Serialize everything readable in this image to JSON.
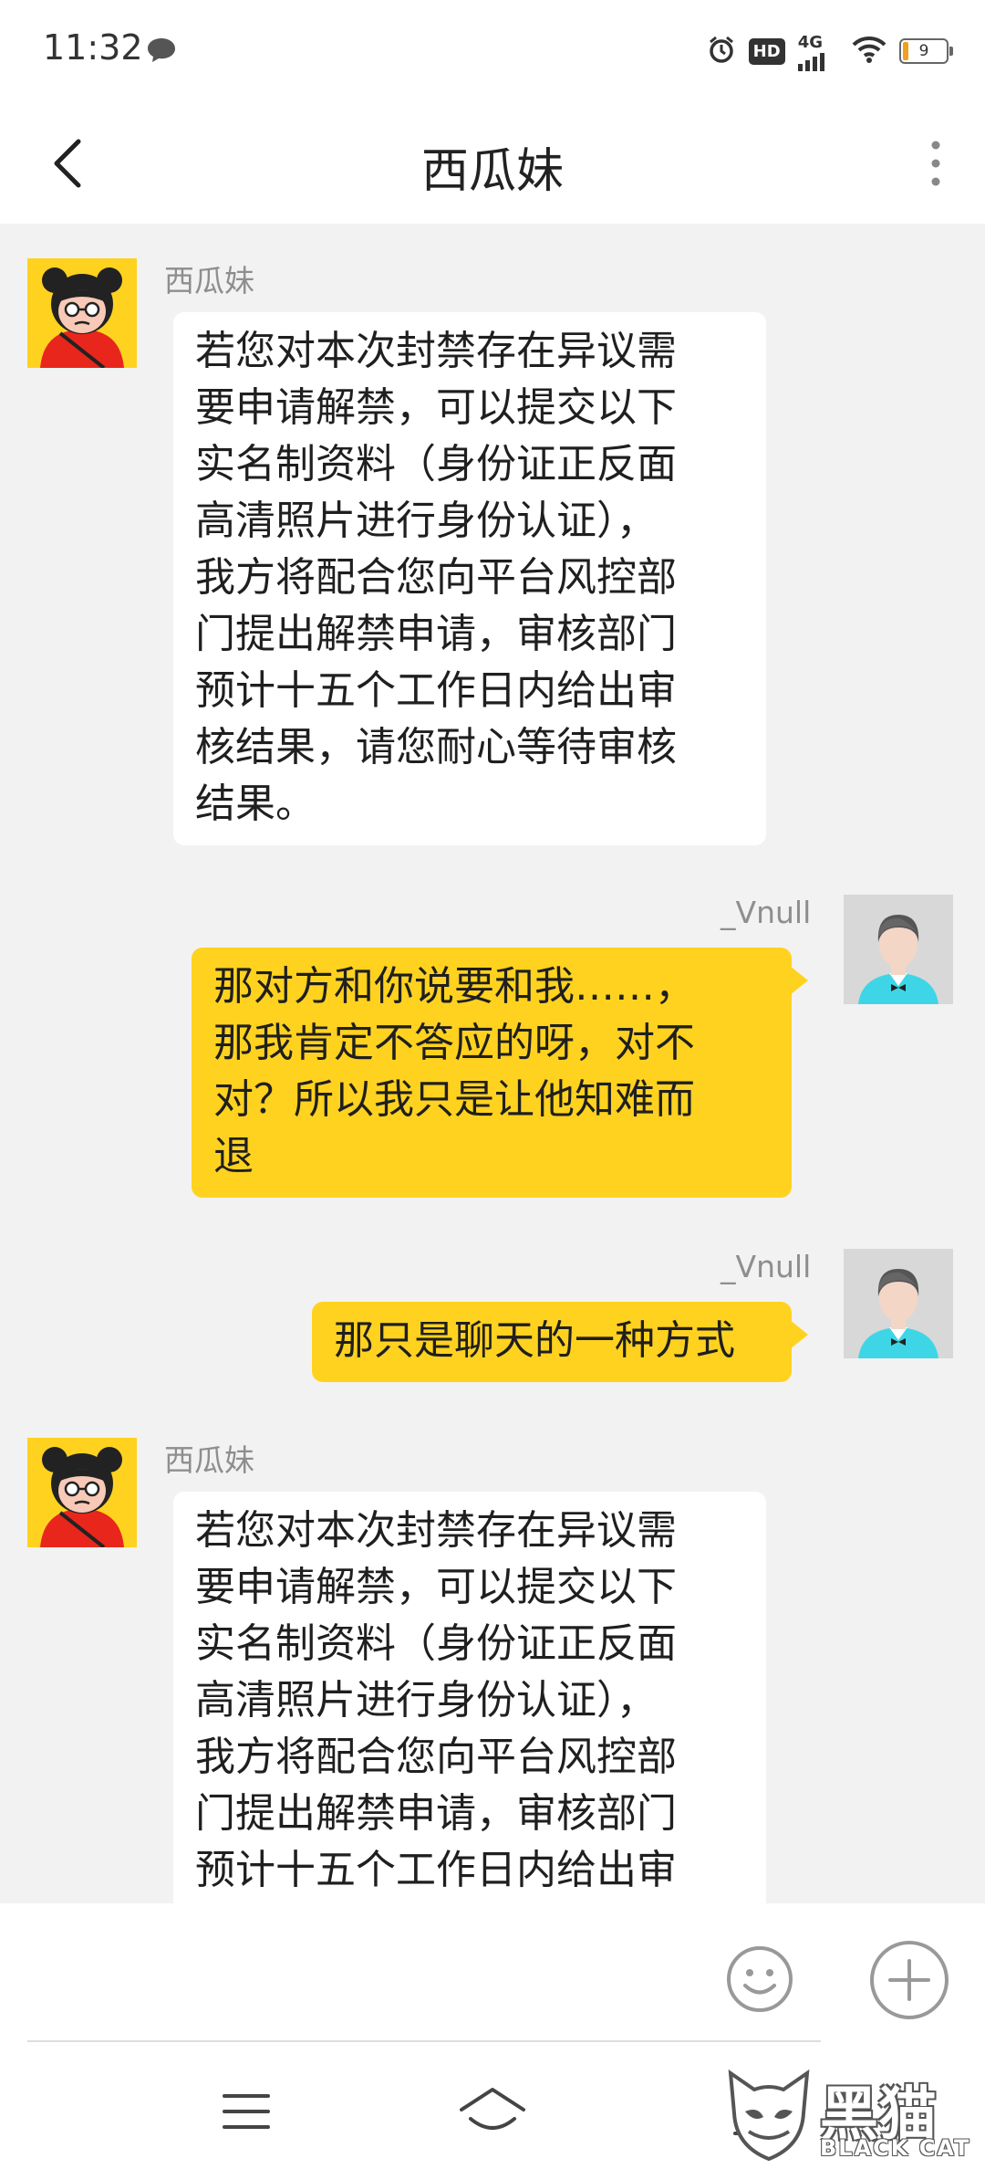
{
  "status_bar": {
    "time": "11:32",
    "network": "4G",
    "hd": "HD",
    "battery": "9"
  },
  "header": {
    "title": "西瓜妹"
  },
  "messages": [
    {
      "direction": "in",
      "sender": "西瓜妹",
      "avatar": "girl-avatar",
      "lines": [
        "若您对本次封禁存在异议需",
        "要申请解禁，可以提交以下",
        "实名制资料（身份证正反面",
        "高清照片进行身份认证），",
        "我方将配合您向平台风控部",
        "门提出解禁申请，审核部门",
        "预计十五个工作日内给出审",
        "核结果，请您耐心等待审核",
        "结果。"
      ]
    },
    {
      "direction": "out",
      "sender": "_Vnull",
      "avatar": "man-avatar",
      "lines": [
        "那对方和你说要和我……，",
        "那我肯定不答应的呀，对不",
        "对？所以我只是让他知难而",
        "退"
      ]
    },
    {
      "direction": "out",
      "sender": "_Vnull",
      "avatar": "man-avatar",
      "lines": [
        "那只是聊天的一种方式"
      ]
    },
    {
      "direction": "in",
      "sender": "西瓜妹",
      "avatar": "girl-avatar",
      "lines": [
        "若您对本次封禁存在异议需",
        "要申请解禁，可以提交以下",
        "实名制资料（身份证正反面",
        "高清照片进行身份认证），",
        "我方将配合您向平台风控部",
        "门提出解禁申请，审核部门",
        "预计十五个工作日内给出审"
      ]
    }
  ],
  "watermark": {
    "text": "黑猫",
    "subtext": "BLACK CAT"
  }
}
